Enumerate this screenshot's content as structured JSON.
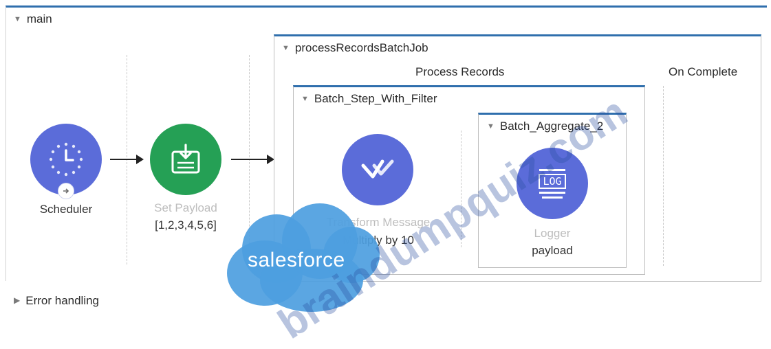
{
  "main_flow": {
    "name": "main",
    "expanded": true
  },
  "scheduler": {
    "label": "Scheduler"
  },
  "set_payload": {
    "label": "Set Payload",
    "value": "[1,2,3,4,5,6]"
  },
  "batch_job": {
    "name": "processRecordsBatchJob",
    "process_records_label": "Process Records",
    "on_complete_label": "On Complete"
  },
  "batch_step": {
    "name": "Batch_Step_With_Filter"
  },
  "transform": {
    "label": "Transform Message",
    "desc": "Multiply by 10"
  },
  "aggregator": {
    "name": "Batch_Aggregate_2"
  },
  "logger": {
    "label": "Logger",
    "value": "payload",
    "icon_text": "LOG"
  },
  "error_handling": {
    "label": "Error handling",
    "expanded": false
  },
  "watermark": {
    "brand": "salesforce",
    "site": "braindumpquiz.com"
  },
  "colors": {
    "flow_border": "#2f6fad",
    "component_blue": "#5b6cd9",
    "component_green": "#25a055",
    "cloud": "#4d9ee0"
  }
}
